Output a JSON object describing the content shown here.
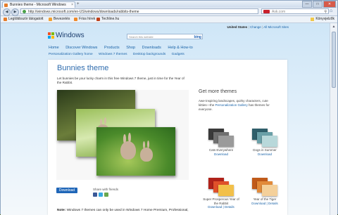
{
  "browser": {
    "tab_title": "Bunnies theme - Microsoft Windows",
    "new_tab": "+",
    "window_controls": [
      "—",
      "□",
      "✕"
    ],
    "nav_buttons": [
      "◀",
      "▶"
    ],
    "url": "http://windows.microsoft.com/en-US/windows/downloads/rabbits-theme",
    "search_placeholder": "Ask.com",
    "search_icon": "magnifier-icon",
    "home_icon": "⌂",
    "bookmarks": [
      {
        "label": "Legtöbbször látogatott",
        "color": "#e57c2a"
      },
      {
        "label": "Bevezetés",
        "color": "#f0a030"
      },
      {
        "label": "Friss hírek",
        "color": "#f08a2a"
      },
      {
        "label": "Techline.hu",
        "color": "#c0401a"
      }
    ],
    "bookmarks_right": "Könyvjelzők"
  },
  "site": {
    "logo_text": "Windows",
    "logo_colors": [
      "#f25022",
      "#7fba00",
      "#00a4ef",
      "#ffb900"
    ],
    "search_placeholder": "Search this website",
    "search_engine": "bing",
    "region": "United States",
    "region_change": "Change",
    "all_sites": "All Microsoft Sites",
    "main_nav": [
      "Home",
      "Discover Windows",
      "Products",
      "Shop",
      "Downloads",
      "Help & How-to"
    ],
    "sub_nav": [
      "Personalization Gallery home",
      "Windows 7 themes",
      "Desktop backgrounds",
      "Gadgets"
    ]
  },
  "content": {
    "title": "Bunnies theme",
    "intro": "Let bunnies be your lucky charm in this free Windows 7 theme, just in time for the Year of the Rabbit.",
    "download_label": "Download",
    "share_label": "Share with friends",
    "share_colors": [
      "#3b5998",
      "#39a9e0",
      "#6aa84f"
    ],
    "note_bold": "Note:",
    "note_text": " Windows 7 themes can only be used in Windows 7 Home Premium, Professional,"
  },
  "sidebar": {
    "heading": "Get more themes",
    "text_before": "Awe-inspiring landscapes, quirky characters, cute kitties—the ",
    "link": "Personalization Gallery",
    "text_after": " has themes for everyone.",
    "themes": [
      {
        "name": "Cats Everywhere",
        "links": [
          "Download"
        ],
        "colors": [
          "#3a3a3a",
          "#707070",
          "#9a9a9a"
        ]
      },
      {
        "name": "Dogs in Summer",
        "links": [
          "Download"
        ],
        "colors": [
          "#2f5e6a",
          "#6aa0a8",
          "#b8d8da"
        ]
      },
      {
        "name": "Super Prosperous Year of the Rabbit",
        "links": [
          "Download",
          "Details"
        ],
        "colors": [
          "#b0221a",
          "#e0502a",
          "#f2c04a"
        ]
      },
      {
        "name": "Year of the Tiger",
        "links": [
          "Download",
          "Details"
        ],
        "colors": [
          "#c05a1a",
          "#e28a3a",
          "#f4d09a"
        ]
      }
    ]
  }
}
